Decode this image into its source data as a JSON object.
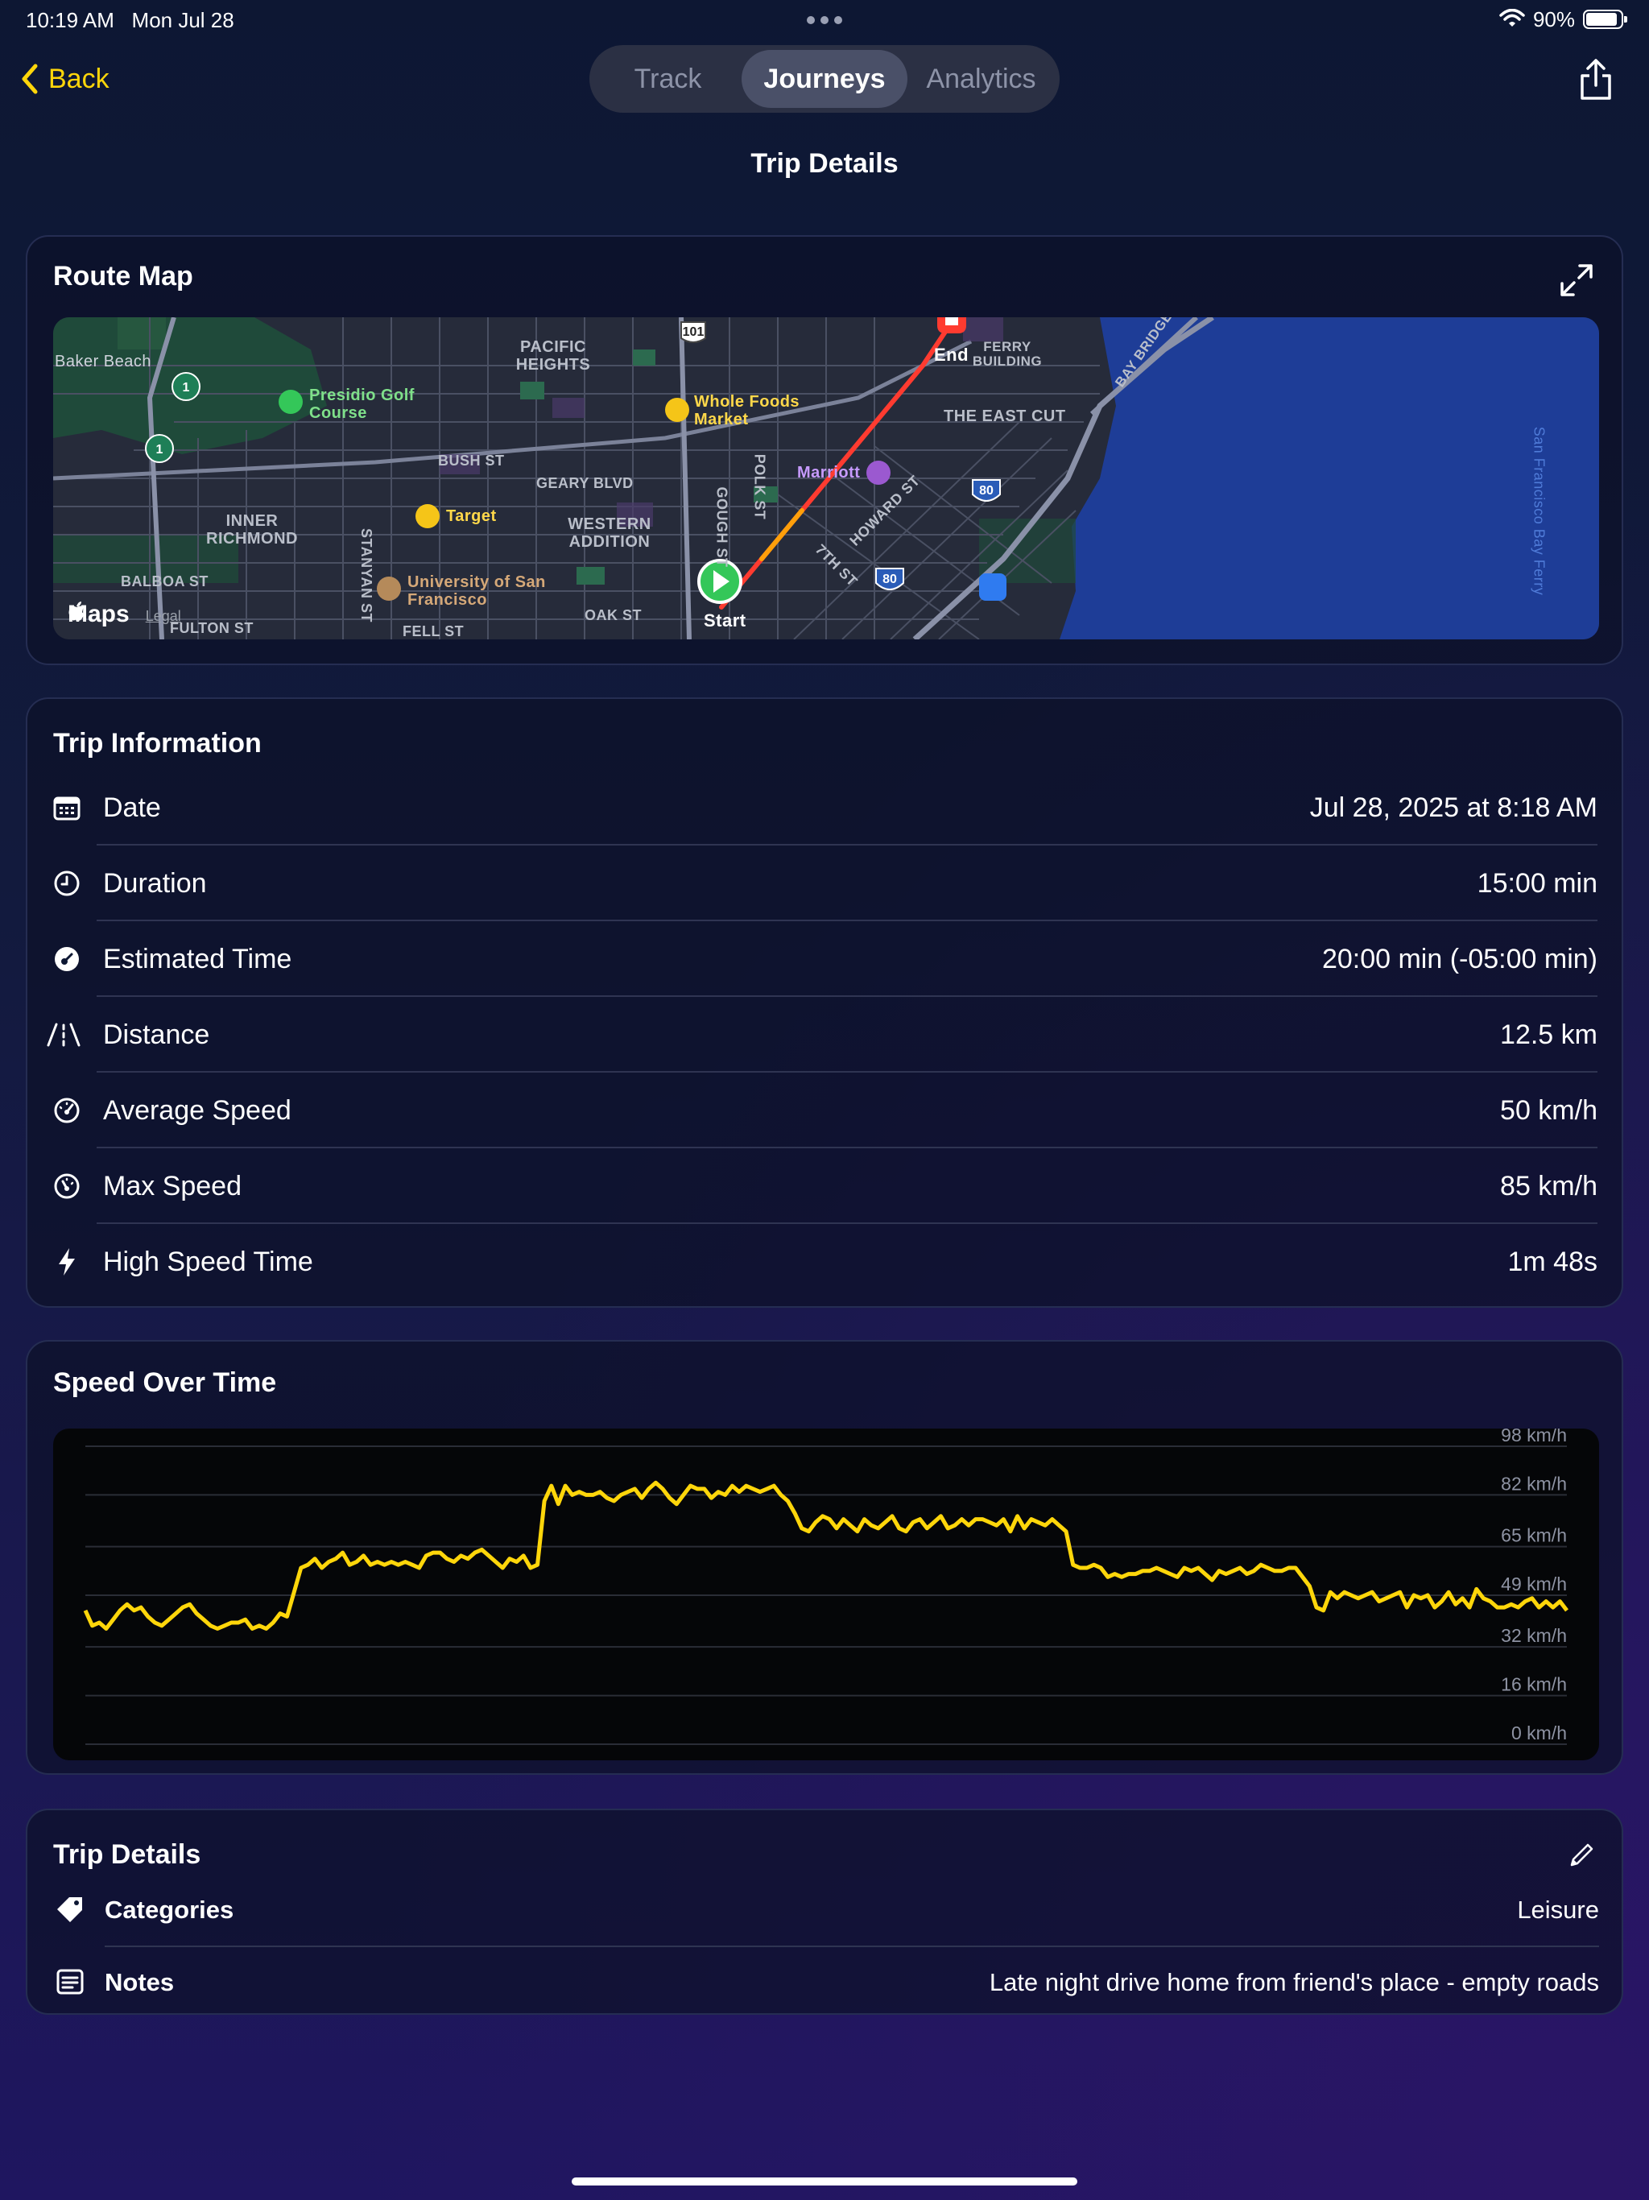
{
  "status_bar": {
    "time": "10:19 AM",
    "date": "Mon Jul 28",
    "battery": "90%",
    "battery_level": 0.9
  },
  "nav": {
    "back_label": "Back",
    "tabs": [
      {
        "label": "Track",
        "active": false
      },
      {
        "label": "Journeys",
        "active": true
      },
      {
        "label": "Analytics",
        "active": false
      }
    ],
    "page_title": "Trip Details"
  },
  "route_map": {
    "title": "Route Map",
    "start_label": "Start",
    "end_label": "End",
    "brand": "Maps",
    "legal": "Legal",
    "places": [
      "Baker Beach",
      "PACIFIC HEIGHTS",
      "Presidio Golf Course",
      "Whole Foods Market",
      "THE EAST CUT",
      "FERRY BUILDING",
      "Marriott",
      "INNER RICHMOND",
      "Target",
      "WESTERN ADDITION",
      "University of San Francisco",
      "BUSH ST",
      "GEARY BLVD",
      "BALBOA ST",
      "FULTON ST",
      "OAK ST",
      "FELL ST",
      "HOWARD ST",
      "7TH ST",
      "POLK ST",
      "GOUGH ST",
      "STANYAN ST",
      "San Francisco Bay Ferry",
      "BAY BRIDGE"
    ],
    "route_shields": [
      "101",
      "1",
      "80"
    ]
  },
  "trip_information": {
    "title": "Trip Information",
    "rows": [
      {
        "icon": "calendar-icon",
        "label": "Date",
        "value": "Jul 28, 2025 at 8:18 AM"
      },
      {
        "icon": "clock-icon",
        "label": "Duration",
        "value": "15:00 min"
      },
      {
        "icon": "timer-icon",
        "label": "Estimated Time",
        "value": "20:00 min (-05:00 min)"
      },
      {
        "icon": "road-icon",
        "label": "Distance",
        "value": "12.5 km"
      },
      {
        "icon": "speedometer-icon",
        "label": "Average Speed",
        "value": "50 km/h"
      },
      {
        "icon": "gauge-icon",
        "label": "Max Speed",
        "value": "85 km/h"
      },
      {
        "icon": "bolt-icon",
        "label": "High Speed Time",
        "value": "1m 48s"
      }
    ]
  },
  "speed_chart": {
    "title": "Speed Over Time",
    "accent_color": "#ffd60a"
  },
  "chart_data": {
    "type": "line",
    "title": "Speed Over Time",
    "xlabel": "",
    "ylabel": "",
    "y_ticks": [
      "98 km/h",
      "82 km/h",
      "65 km/h",
      "49 km/h",
      "32 km/h",
      "16 km/h",
      "0 km/h"
    ],
    "y_tick_values": [
      98,
      82,
      65,
      49,
      32,
      16,
      0
    ],
    "ylim": [
      0,
      98
    ],
    "grid": true,
    "series": [
      {
        "color": "#ffd60a",
        "values": [
          44,
          39,
          40,
          38,
          41,
          44,
          46,
          44,
          45,
          42,
          40,
          39,
          41,
          43,
          45,
          46,
          43,
          41,
          39,
          38,
          39,
          40,
          40,
          41,
          38,
          39,
          38,
          40,
          43,
          42,
          50,
          58,
          59,
          61,
          58,
          60,
          61,
          63,
          59,
          60,
          62,
          59,
          60,
          59,
          60,
          59,
          60,
          59,
          58,
          62,
          63,
          63,
          61,
          60,
          62,
          61,
          63,
          64,
          62,
          60,
          58,
          61,
          60,
          62,
          58,
          59,
          80,
          85,
          79,
          85,
          82,
          83,
          82,
          82,
          83,
          81,
          80,
          82,
          83,
          84,
          81,
          84,
          86,
          84,
          81,
          79,
          82,
          85,
          84,
          84,
          81,
          83,
          82,
          85,
          83,
          85,
          84,
          83,
          84,
          85,
          82,
          80,
          76,
          71,
          70,
          73,
          75,
          74,
          71,
          74,
          72,
          70,
          74,
          72,
          71,
          73,
          75,
          71,
          70,
          73,
          74,
          71,
          73,
          75,
          71,
          72,
          74,
          72,
          74,
          74,
          73,
          72,
          74,
          70,
          75,
          71,
          74,
          73,
          72,
          74,
          72,
          70,
          59,
          58,
          58,
          59,
          58,
          55,
          56,
          55,
          56,
          56,
          57,
          57,
          58,
          57,
          56,
          55,
          58,
          57,
          58,
          56,
          54,
          57,
          56,
          57,
          58,
          56,
          57,
          59,
          58,
          57,
          57,
          58,
          58,
          55,
          52,
          45,
          44,
          50,
          48,
          50,
          49,
          48,
          49,
          50,
          47,
          48,
          49,
          50,
          45,
          49,
          48,
          49,
          45,
          47,
          50,
          46,
          48,
          45,
          51,
          48,
          47,
          45,
          45,
          46,
          45,
          47,
          48,
          45,
          47,
          45,
          47,
          44
        ]
      }
    ]
  },
  "trip_details": {
    "title": "Trip Details",
    "rows": [
      {
        "icon": "tag-icon",
        "label": "Categories",
        "value": "Leisure"
      },
      {
        "icon": "notes-icon",
        "label": "Notes",
        "value": "Late night drive home from friend's place - empty roads"
      }
    ]
  }
}
